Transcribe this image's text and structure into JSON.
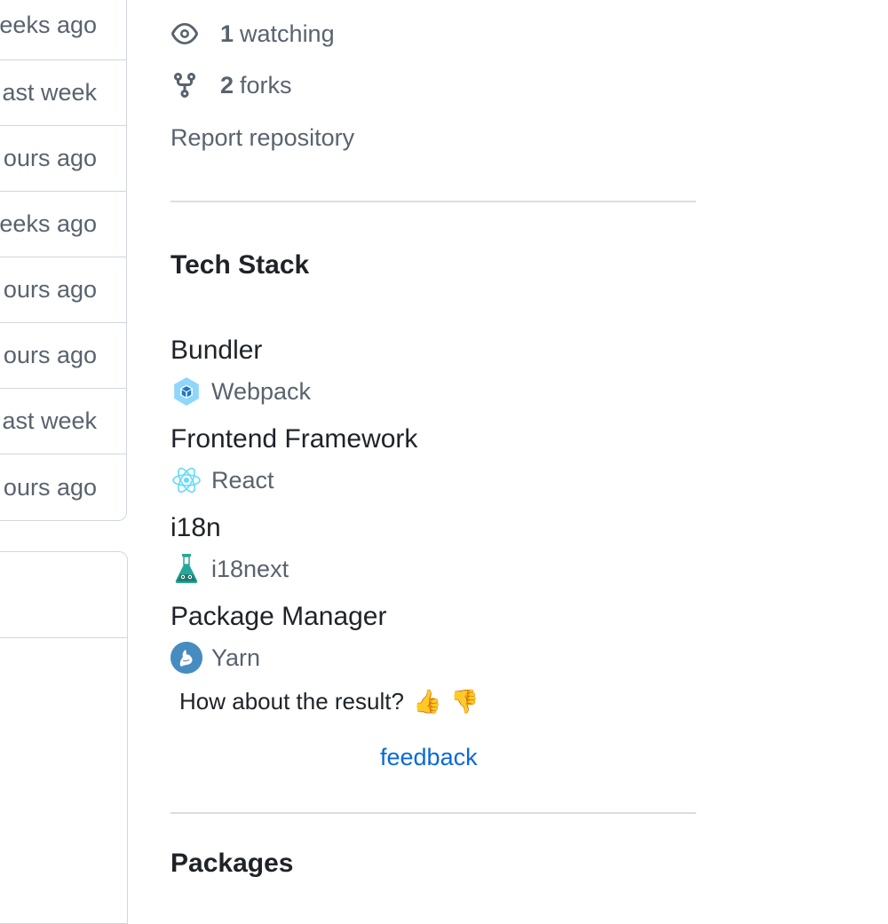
{
  "file_list": {
    "times": [
      "eeks ago",
      "ast week",
      "ours ago",
      "eeks ago",
      "ours ago",
      "ours ago",
      "ast week",
      "ours ago"
    ]
  },
  "about": {
    "watching_count": "1",
    "watching_label": "watching",
    "forks_count": "2",
    "forks_label": "forks",
    "report_label": "Report repository"
  },
  "tech_stack": {
    "title": "Tech Stack",
    "categories": [
      {
        "name": "Bundler",
        "tool": "Webpack",
        "icon": "webpack-icon"
      },
      {
        "name": "Frontend Framework",
        "tool": "React",
        "icon": "react-icon"
      },
      {
        "name": "i18n",
        "tool": "i18next",
        "icon": "i18next-icon"
      },
      {
        "name": "Package Manager",
        "tool": "Yarn",
        "icon": "yarn-icon"
      }
    ],
    "feedback_question": "How about the result?",
    "thumbs_up": "👍",
    "thumbs_down": "👎",
    "feedback_link": "feedback"
  },
  "packages": {
    "title": "Packages"
  },
  "colors": {
    "link": "#0969da",
    "muted": "#59636e",
    "border": "#d0d7de"
  }
}
